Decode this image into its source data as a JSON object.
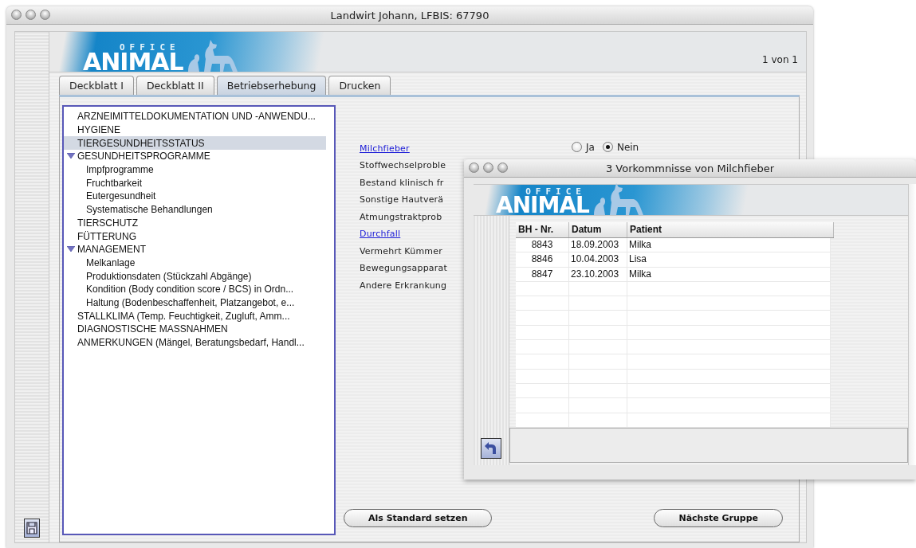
{
  "window": {
    "title": "Landwirt Johann, LFBIS: 67790"
  },
  "logo": {
    "small": "OFFICE",
    "big": "ANIMAL"
  },
  "page_indicator": "1 von 1",
  "tabs": [
    {
      "label": "Deckblatt I",
      "selected": false
    },
    {
      "label": "Deckblatt II",
      "selected": false
    },
    {
      "label": "Betriebserhebung",
      "selected": true
    },
    {
      "label": "Drucken",
      "selected": false
    }
  ],
  "tree": [
    {
      "label": "ARZNEIMITTELDOKUMENTATION UND -ANWENDU...",
      "selected": false
    },
    {
      "label": "HYGIENE",
      "selected": false
    },
    {
      "label": "TIERGESUNDHEITSSTATUS",
      "selected": true
    },
    {
      "label": "GESUNDHEITSPROGRAMME",
      "selected": false,
      "expanded": true,
      "children": [
        {
          "label": "Impfprogramme",
          "selected": false
        },
        {
          "label": "Fruchtbarkeit",
          "selected": false
        },
        {
          "label": "Eutergesundheit",
          "selected": false
        },
        {
          "label": "Systematische Behandlungen",
          "selected": false
        }
      ]
    },
    {
      "label": "TIERSCHUTZ",
      "selected": false
    },
    {
      "label": "FÜTTERUNG",
      "selected": false
    },
    {
      "label": "MANAGEMENT",
      "selected": false,
      "expanded": true,
      "children": [
        {
          "label": "Melkanlage",
          "selected": false
        },
        {
          "label": "Produktionsdaten (Stückzahl Abgänge)",
          "selected": false
        },
        {
          "label": "Kondition (Body condition score / BCS) in Ordn...",
          "selected": false
        },
        {
          "label": "Haltung (Bodenbeschaffenheit, Platzangebot, e...",
          "selected": false
        }
      ]
    },
    {
      "label": "STALLKLIMA (Temp. Feuchtigkeit, Zugluft, Amm...",
      "selected": false
    },
    {
      "label": "DIAGNOSTISCHE MASSNAHMEN",
      "selected": false
    },
    {
      "label": "ANMERKUNGEN (Mängel, Beratungsbedarf, Handl...",
      "selected": false
    }
  ],
  "questions": [
    {
      "label": "Milchfieber",
      "kind": "link",
      "options": [
        {
          "label": "Ja",
          "selected": false
        },
        {
          "label": "Nein",
          "selected": true
        }
      ]
    },
    {
      "label": "Stoffwechselproble",
      "kind": "plain"
    },
    {
      "label": "Bestand klinisch fr",
      "kind": "plain"
    },
    {
      "label": "Sonstige Hautverä",
      "kind": "plain"
    },
    {
      "label": "Atmungstraktprob",
      "kind": "plain"
    },
    {
      "label": "Durchfall",
      "kind": "link"
    },
    {
      "label": "Vermehrt Kümmer",
      "kind": "plain"
    },
    {
      "label": "Bewegungsapparat",
      "kind": "plain"
    },
    {
      "label": "Andere Erkrankung",
      "kind": "plain"
    }
  ],
  "buttons": [
    "Als Standard setzen",
    "Nächste Gruppe"
  ],
  "dialog": {
    "title": "3 Vorkommnisse von Milchfieber",
    "logo": {
      "small": "OFFICE",
      "big": "ANIMAL"
    },
    "columns": [
      "BH - Nr.",
      "Datum",
      "Patient"
    ],
    "rows": [
      [
        "8843",
        "18.09.2003",
        "Milka"
      ],
      [
        "8846",
        "10.04.2003",
        "Lisa"
      ],
      [
        "8847",
        "23.10.2003",
        "Milka"
      ]
    ]
  }
}
